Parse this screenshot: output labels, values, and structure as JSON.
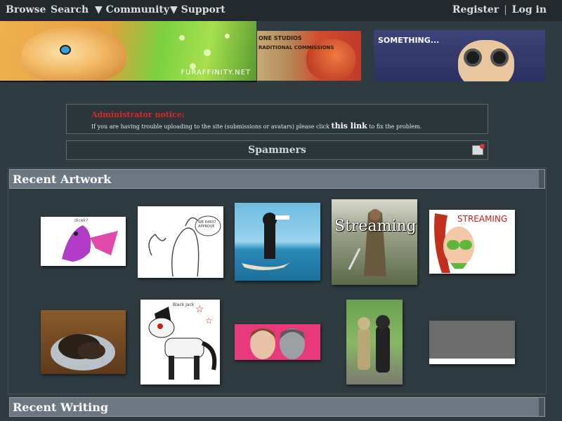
{
  "nav": {
    "browse": "Browse",
    "search": "Search",
    "community": "▼ Community",
    "support": "▼ Support",
    "register": "Register",
    "separator": "|",
    "login": "Log in"
  },
  "banners": {
    "main_wordmark": "FURAFFINITY.NET",
    "mid_line1": "ONE STUDIOS",
    "mid_line2": "RADITIONAL COMMISSIONS",
    "right_caption": "SOMETHING..."
  },
  "notice": {
    "title": "Administrator notice:",
    "body_before": "If you are having trouble uploading to the site (submissions or avatars) please click ",
    "link_text": "this link",
    "body_after": " to fix the problem."
  },
  "spammers": {
    "label": "Spammers",
    "icon": "report-icon"
  },
  "sections": {
    "recent_artwork": "Recent Artwork",
    "recent_writing": "Recent Writing"
  },
  "thumbnails": [
    {
      "name": "thumb-purple-dragon",
      "label": "dicek?"
    },
    {
      "name": "thumb-sketch-character",
      "label": "WE 64837 APPROVE"
    },
    {
      "name": "thumb-boat-character"
    },
    {
      "name": "thumb-streaming-warrior",
      "label": "Streaming"
    },
    {
      "name": "thumb-streaming-bikini",
      "label": "STREAMING"
    },
    {
      "name": "thumb-puppies-basket"
    },
    {
      "name": "thumb-striped-pony",
      "label": "Black Jack"
    },
    {
      "name": "thumb-two-faces"
    },
    {
      "name": "thumb-fursuits-outdoors"
    },
    {
      "name": "thumb-gray-placeholder"
    }
  ],
  "colors": {
    "page_bg": "#2e3b41",
    "nav_bg": "#23282c",
    "notice_title": "#e02424",
    "section_header": "#6d7783"
  }
}
